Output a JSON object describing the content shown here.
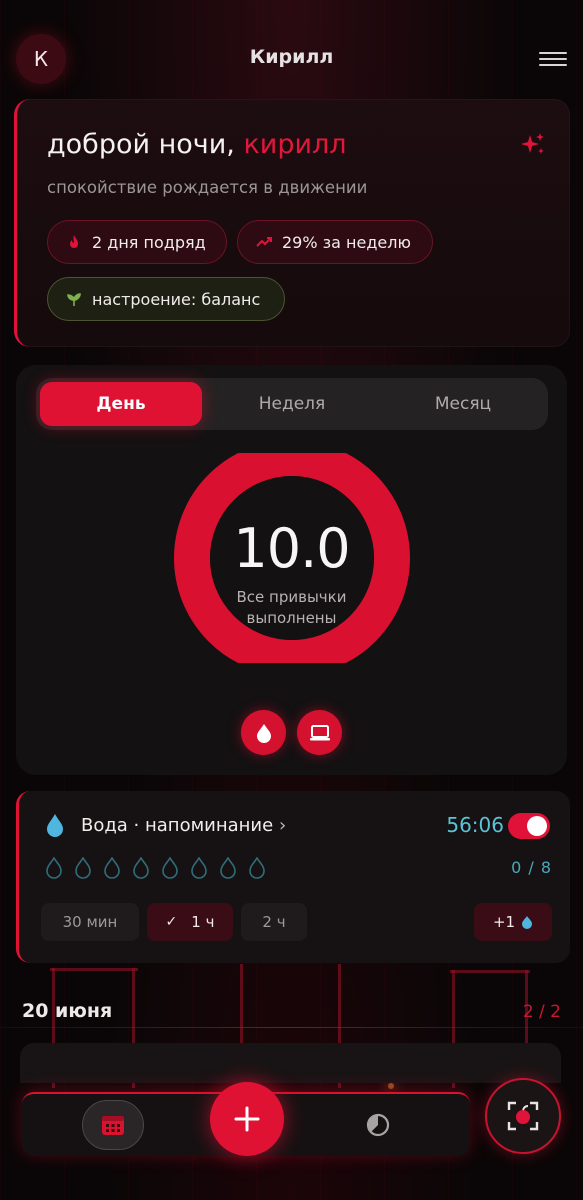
{
  "header": {
    "avatar_letter": "К",
    "title": "Кирилл"
  },
  "greeting": {
    "prefix": "доброй ночи, ",
    "name": "кирилл",
    "subtitle": "спокойствие рождается в движении",
    "chips": [
      {
        "label": "2 дня подряд",
        "icon": "flame-icon"
      },
      {
        "label": "29% за неделю",
        "icon": "trend-up-icon"
      },
      {
        "label": "настроение: баланс",
        "icon": "sprout-icon"
      }
    ]
  },
  "period_tabs": {
    "items": [
      "День",
      "Неделя",
      "Месяц"
    ],
    "active": "День"
  },
  "progress": {
    "value": "10.0",
    "caption_line1": "Все привычки",
    "caption_line2": "выполнены",
    "fill_fraction": 1.0
  },
  "habit_icons": [
    "drop-icon",
    "laptop-icon"
  ],
  "water": {
    "title": "Вода · напоминание",
    "timer": "56:06",
    "reminder_enabled": true,
    "drops_total": 8,
    "drops_filled": 0,
    "count": "0 / 8",
    "intervals": [
      "30 мин",
      "1 ч",
      "2 ч"
    ],
    "active_interval": "1 ч",
    "add_label": "+1"
  },
  "day_section": {
    "date": "20 июня",
    "count": "2 / 2"
  },
  "colors": {
    "accent": "#DF1234",
    "cyan": "#59C3D8",
    "background": "#0A0607"
  }
}
